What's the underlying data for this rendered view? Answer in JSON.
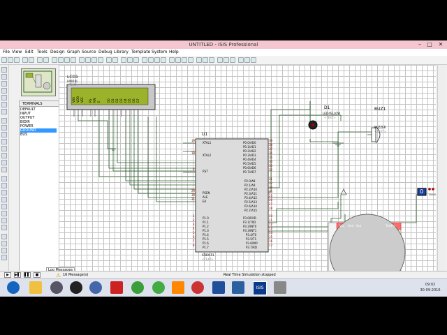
{
  "window": {
    "title": "UNTITLED - ISIS Professional",
    "min": "–",
    "max": "□",
    "close": "✕"
  },
  "menu": [
    "File",
    "View",
    "Edit",
    "Tools",
    "Design",
    "Graph",
    "Source",
    "Debug",
    "Library",
    "Template",
    "System",
    "Help"
  ],
  "terminals_panel": {
    "header": "TERMINALS",
    "items": [
      "DEFAULT",
      "INPUT",
      "OUTPUT",
      "BIDIR",
      "POWER",
      "GROUND",
      "BUS"
    ],
    "selected": "GROUND"
  },
  "schematic": {
    "lcd": {
      "ref": "LCD1",
      "part": "LM016L",
      "text": "<TEXT>",
      "pins": [
        "VSS",
        "VDD",
        "VEE",
        "RS",
        "RW",
        "E",
        "D0",
        "D1",
        "D2",
        "D3",
        "D4",
        "D5",
        "D6",
        "D7"
      ]
    },
    "mcu": {
      "ref": "U1",
      "part": "AT89C51",
      "text": "<TEXT>",
      "left_pins": [
        "XTAL1",
        "XTAL2",
        "RST",
        "PSEN",
        "ALE",
        "EA",
        "P1.0",
        "P1.1",
        "P1.2",
        "P1.3",
        "P1.4",
        "P1.5",
        "P1.6",
        "P1.7"
      ],
      "left_nums": [
        "19",
        "18",
        "9",
        "29",
        "30",
        "31",
        "1",
        "2",
        "3",
        "4",
        "5",
        "6",
        "7",
        "8"
      ],
      "right_pins": [
        "P0.0/AD0",
        "P0.1/AD1",
        "P0.2/AD2",
        "P0.3/AD3",
        "P0.4/AD4",
        "P0.5/AD5",
        "P0.6/AD6",
        "P0.7/AD7",
        "P2.0/A8",
        "P2.1/A9",
        "P2.2/A10",
        "P2.3/A11",
        "P2.4/A12",
        "P2.5/A13",
        "P2.6/A14",
        "P2.7/A15",
        "P3.0/RXD",
        "P3.1/TXD",
        "P3.2/INT0",
        "P3.3/INT1",
        "P3.4/T0",
        "P3.5/T1",
        "P3.6/WR",
        "P3.7/RD"
      ],
      "right_nums": [
        "39",
        "38",
        "37",
        "36",
        "35",
        "34",
        "33",
        "32",
        "21",
        "22",
        "23",
        "24",
        "25",
        "26",
        "27",
        "28",
        "10",
        "11",
        "12",
        "13",
        "14",
        "15",
        "16",
        "17"
      ]
    },
    "led": {
      "ref": "D1",
      "part": "LED-YELLOW",
      "text": "<TEXT>"
    },
    "buzzer": {
      "ref": "BUZ1",
      "part": "BUZZER",
      "text": "<TEXT>"
    },
    "logic_toggle": {
      "value": "0"
    },
    "sensor": {
      "pins": [
        "Vcc",
        "Gnd",
        "Out"
      ],
      "label": "TestPin"
    }
  },
  "simbar": {
    "buttons": [
      "▶",
      "▶▌",
      "▌▌",
      "■"
    ],
    "messages": "16 Message(s)",
    "status": "Real Time Simulation stopped",
    "log_tab": "Log Messages"
  },
  "taskbar": {
    "time": "09:02",
    "date": "30-09-2016",
    "isis_label": "ISIS"
  },
  "colors": {
    "titlebar": "#f3c6d0",
    "canvas_grid": "#c4c4c4",
    "pin_red": "#990000",
    "lcd_screen": "#9ab32a",
    "selection": "#3399ff"
  }
}
